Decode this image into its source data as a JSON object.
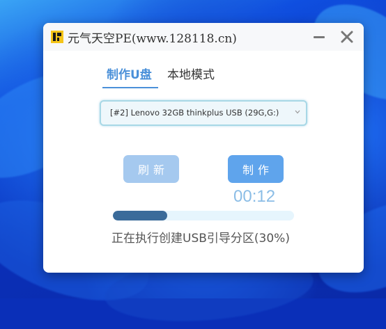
{
  "window": {
    "title": "元气天空PE(www.128118.cn)"
  },
  "tabs": [
    {
      "label": "制作U盘",
      "active": true
    },
    {
      "label": "本地模式",
      "active": false
    }
  ],
  "device_select": {
    "selected": "[#2] Lenovo 32GB thinkplus USB (29G,G:)"
  },
  "buttons": {
    "refresh_label": "刷新",
    "make_label": "制作"
  },
  "timer": "00:12",
  "progress": {
    "fraction": 0.3,
    "status_text": "正在执行创建USB引导分区(30%)"
  },
  "icons": {
    "logo": "app-logo-icon",
    "minimize": "minimize-icon",
    "close": "close-icon",
    "dropdown": "chevron-down-icon"
  },
  "colors": {
    "accent": "#4a90d9",
    "make_button": "#5fa4ec",
    "refresh_button": "#a5c9ef",
    "progress_fill": "#3b6b9a",
    "progress_track": "#e6f5fd",
    "timer": "#8bbde6"
  }
}
